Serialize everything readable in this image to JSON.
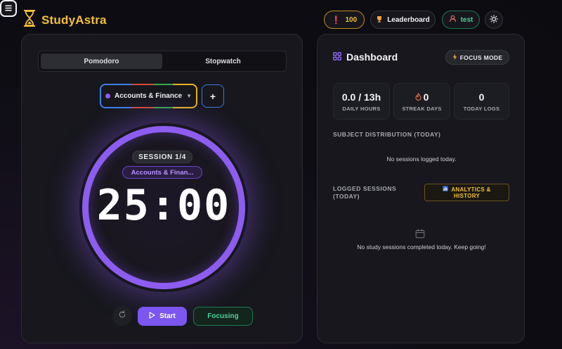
{
  "header": {
    "brand": "StudyAstra",
    "coins": "100",
    "leaderboard_label": "Leaderboard",
    "user_label": "test"
  },
  "timer": {
    "modes": [
      "Pomodoro",
      "Stopwatch"
    ],
    "active_mode": "Pomodoro",
    "subject": "Accounts & Finance",
    "add_subject_label": "+",
    "session_badge": "SESSION 1/4",
    "subject_pill": "Accounts & Finan...",
    "time_display": "25:00",
    "start_label": "Start",
    "focusing_label": "Focusing"
  },
  "dashboard": {
    "title": "Dashboard",
    "focus_mode_label": "FOCUS MODE",
    "stats": [
      {
        "value": "0.0 / 13h",
        "label": "DAILY HOURS"
      },
      {
        "value": "0",
        "label": "STREAK DAYS"
      },
      {
        "value": "0",
        "label": "TODAY LOGS"
      }
    ],
    "subject_distribution_label": "SUBJECT DISTRIBUTION (TODAY)",
    "subject_distribution_empty": "No sessions logged today.",
    "logged_sessions_label_1": "LOGGED SESSIONS",
    "logged_sessions_label_2": "(TODAY)",
    "analytics_label_1": "ANALYTICS &",
    "analytics_label_2": "HISTORY",
    "logged_sessions_empty": "No study sessions completed today. Keep going!"
  },
  "colors": {
    "accent_purple": "#8d5cf0",
    "brand_gold": "#f4c03a",
    "success_green": "#4ad198"
  }
}
